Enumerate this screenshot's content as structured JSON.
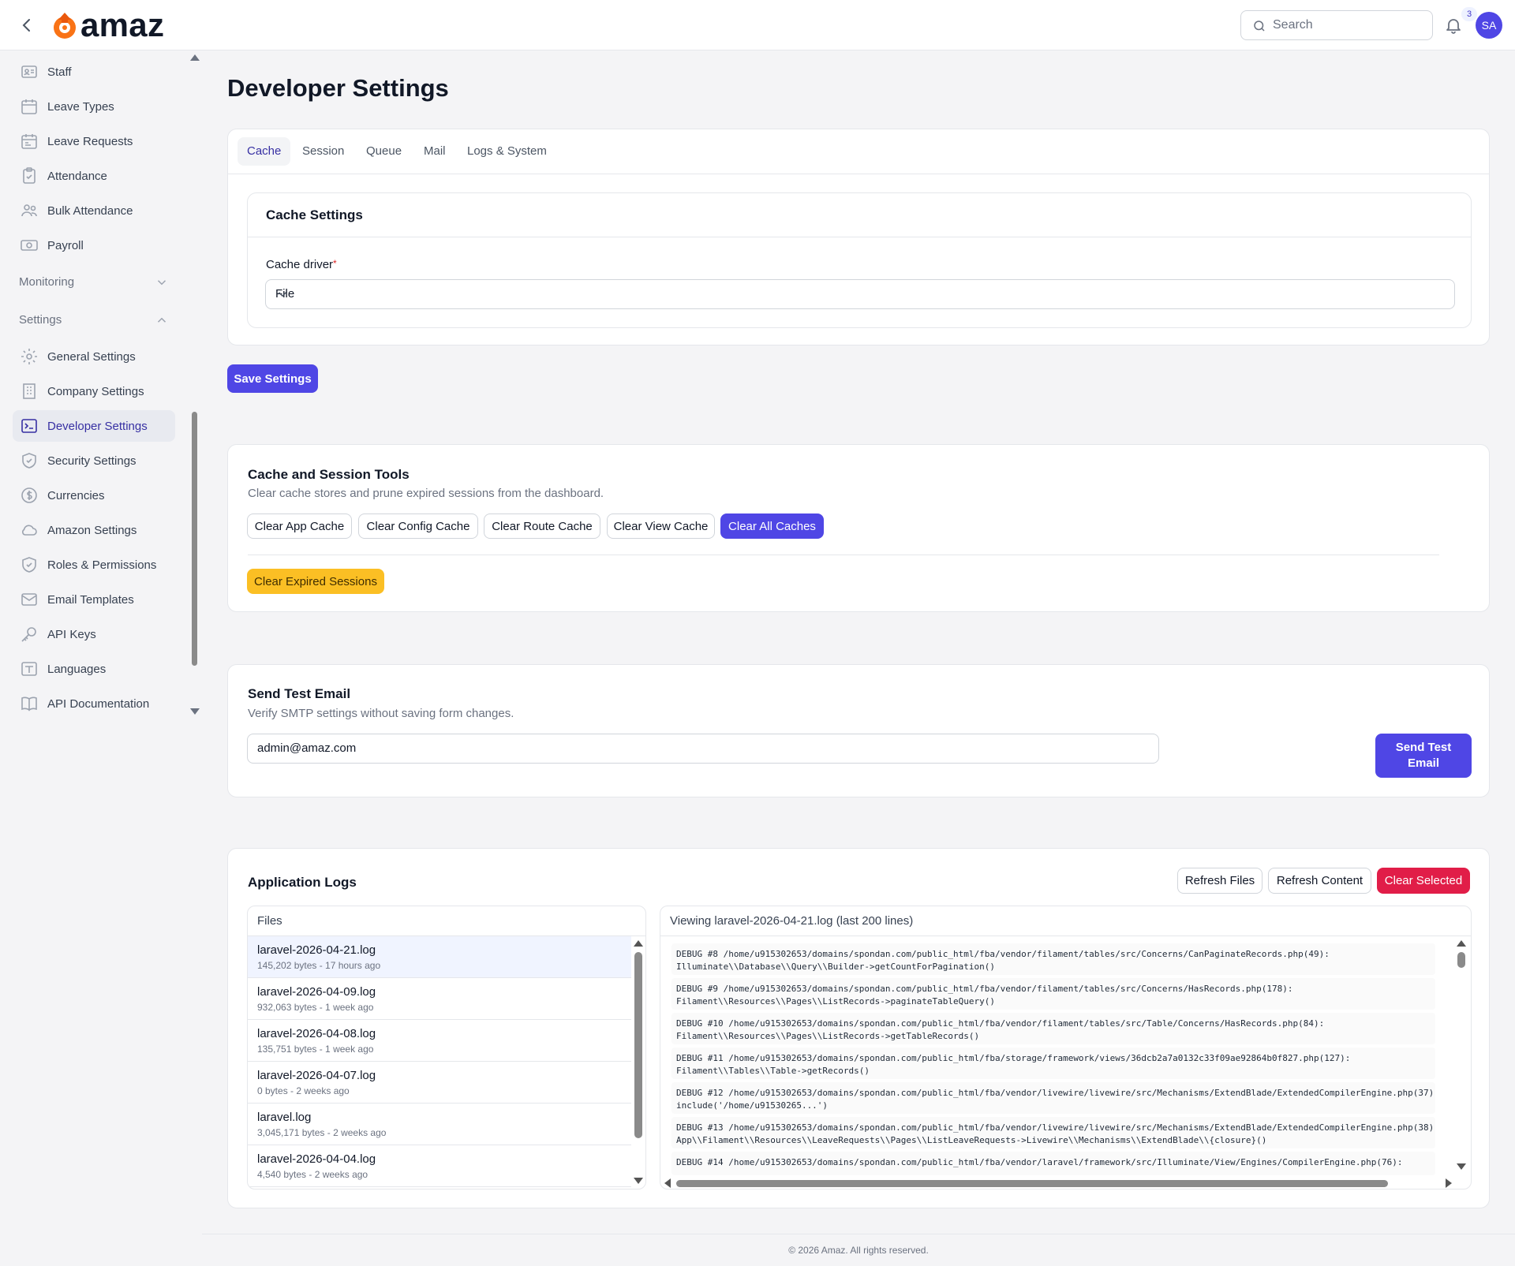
{
  "app": {
    "brand": "amaz"
  },
  "topbar": {
    "search_placeholder": "Search",
    "notification_count": "3",
    "avatar_initials": "SA"
  },
  "sidebar": {
    "items_top": [
      {
        "label": "Staff",
        "icon": "id-card-icon"
      },
      {
        "label": "Leave Types",
        "icon": "calendar-icon"
      },
      {
        "label": "Leave Requests",
        "icon": "calendar-list-icon"
      },
      {
        "label": "Attendance",
        "icon": "clipboard-check-icon"
      },
      {
        "label": "Bulk Attendance",
        "icon": "users-icon"
      },
      {
        "label": "Payroll",
        "icon": "banknote-icon"
      }
    ],
    "groups": [
      {
        "label": "Monitoring",
        "expanded": false
      },
      {
        "label": "Settings",
        "expanded": true
      }
    ],
    "settings_items": [
      {
        "label": "General Settings",
        "icon": "gear-icon"
      },
      {
        "label": "Company Settings",
        "icon": "building-icon"
      },
      {
        "label": "Developer Settings",
        "icon": "terminal-icon",
        "active": true
      },
      {
        "label": "Security Settings",
        "icon": "shield-icon"
      },
      {
        "label": "Currencies",
        "icon": "currency-icon"
      },
      {
        "label": "Amazon Settings",
        "icon": "cloud-icon"
      },
      {
        "label": "Roles & Permissions",
        "icon": "shield-check-icon"
      },
      {
        "label": "Email Templates",
        "icon": "envelope-icon"
      },
      {
        "label": "API Keys",
        "icon": "key-icon"
      },
      {
        "label": "Languages",
        "icon": "language-icon"
      },
      {
        "label": "API Documentation",
        "icon": "book-icon"
      }
    ]
  },
  "page": {
    "title": "Developer Settings"
  },
  "settings_tabs": {
    "tabs": [
      "Cache",
      "Session",
      "Queue",
      "Mail",
      "Logs & System"
    ],
    "active": "Cache"
  },
  "cache_settings": {
    "title": "Cache Settings",
    "driver_label": "Cache driver",
    "required_mark": "*",
    "driver_value": "File",
    "save_label": "Save Settings"
  },
  "cache_tools": {
    "title": "Cache and Session Tools",
    "description": "Clear cache stores and prune expired sessions from the dashboard.",
    "buttons": [
      "Clear App Cache",
      "Clear Config Cache",
      "Clear Route Cache",
      "Clear View Cache",
      "Clear All Caches"
    ],
    "expired_label": "Clear Expired Sessions"
  },
  "test_email": {
    "title": "Send Test Email",
    "description": "Verify SMTP settings without saving form changes.",
    "value": "admin@amaz.com",
    "button_line1": "Send Test",
    "button_line2": "Email"
  },
  "app_logs": {
    "title": "Application Logs",
    "refresh_files": "Refresh Files",
    "refresh_content": "Refresh Content",
    "clear_selected": "Clear Selected",
    "files_header": "Files",
    "viewer_header": "Viewing laravel-2026-04-21.log (last 200 lines)",
    "files": [
      {
        "name": "laravel-2026-04-21.log",
        "meta": "145,202 bytes - 17 hours ago",
        "selected": true
      },
      {
        "name": "laravel-2026-04-09.log",
        "meta": "932,063 bytes - 1 week ago"
      },
      {
        "name": "laravel-2026-04-08.log",
        "meta": "135,751 bytes - 1 week ago"
      },
      {
        "name": "laravel-2026-04-07.log",
        "meta": "0 bytes - 2 weeks ago"
      },
      {
        "name": "laravel.log",
        "meta": "3,045,171 bytes - 2 weeks ago"
      },
      {
        "name": "laravel-2026-04-04.log",
        "meta": "4,540 bytes - 2 weeks ago"
      }
    ],
    "lines": [
      "DEBUG #8 /home/u915302653/domains/spondan.com/public_html/fba/vendor/filament/tables/src/Concerns/CanPaginateRecords.php(49):\nIlluminate\\\\Database\\\\Query\\\\Builder->getCountForPagination()",
      "DEBUG #9 /home/u915302653/domains/spondan.com/public_html/fba/vendor/filament/tables/src/Concerns/HasRecords.php(178):\nFilament\\\\Resources\\\\Pages\\\\ListRecords->paginateTableQuery()",
      "DEBUG #10 /home/u915302653/domains/spondan.com/public_html/fba/vendor/filament/tables/src/Table/Concerns/HasRecords.php(84):\nFilament\\\\Resources\\\\Pages\\\\ListRecords->getTableRecords()",
      "DEBUG #11 /home/u915302653/domains/spondan.com/public_html/fba/storage/framework/views/36dcb2a7a0132c33f09ae92864b0f827.php(127):\nFilament\\\\Tables\\\\Table->getRecords()",
      "DEBUG #12 /home/u915302653/domains/spondan.com/public_html/fba/vendor/livewire/livewire/src/Mechanisms/ExtendBlade/ExtendedCompilerEngine.php(37):\ninclude('/home/u91530265...')",
      "DEBUG #13 /home/u915302653/domains/spondan.com/public_html/fba/vendor/livewire/livewire/src/Mechanisms/ExtendBlade/ExtendedCompilerEngine.php(38):\nApp\\\\Filament\\\\Resources\\\\LeaveRequests\\\\Pages\\\\ListLeaveRequests->Livewire\\\\Mechanisms\\\\ExtendBlade\\\\{closure}()",
      "DEBUG #14 /home/u915302653/domains/spondan.com/public_html/fba/vendor/laravel/framework/src/Illuminate/View/Engines/CompilerEngine.php(76):"
    ]
  },
  "footer": {
    "text": "© 2026 Amaz. All rights reserved."
  },
  "colors": {
    "primary": "#4f46e5",
    "warning": "#fbbf24",
    "danger": "#e11d48",
    "active_nav": "#3730a3"
  }
}
